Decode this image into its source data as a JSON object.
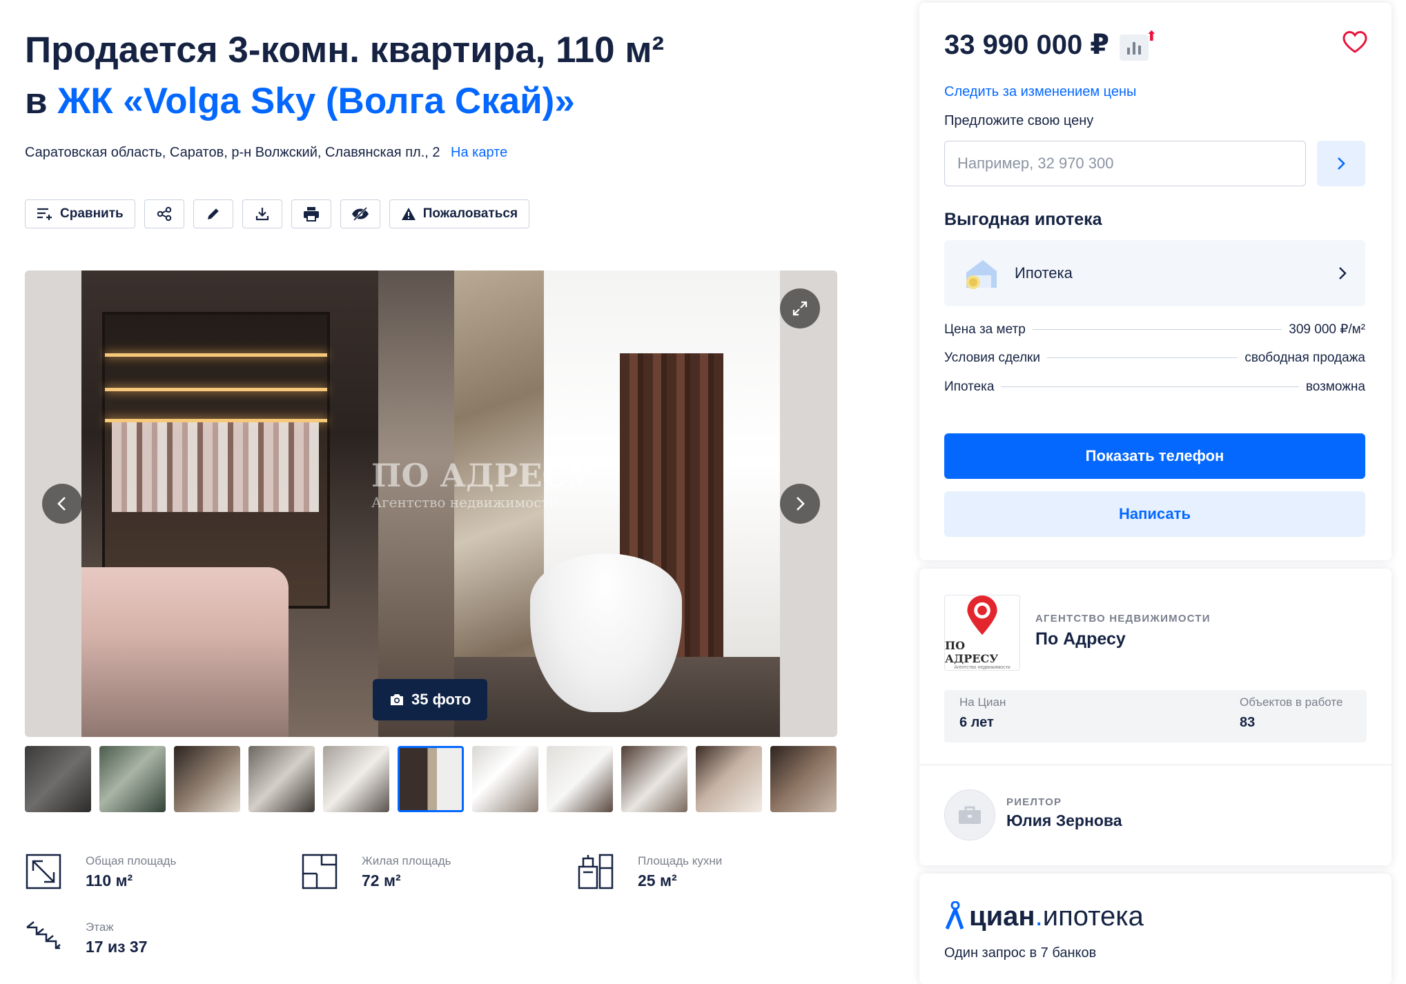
{
  "listing": {
    "title_line1": "Продается 3-комн. квартира, 110 м²",
    "title_prefix": "в",
    "complex_name": "ЖК «Volga Sky (Волга Скай)»",
    "address": "Саратовская область, Саратов, р-н Волжский, Славянская пл., 2",
    "map_link": "На карте"
  },
  "toolbar": {
    "compare_label": "Сравнить",
    "complain_label": "Пожаловаться",
    "icons": [
      "compare-icon",
      "share-icon",
      "edit-icon",
      "download-icon",
      "print-icon",
      "hide-icon",
      "warning-icon"
    ]
  },
  "gallery": {
    "photo_count_label": "35 фото",
    "watermark_title": "ПО АДРЕСУ",
    "watermark_sub": "Агентство недвижимости",
    "thumbnails_visible": 11,
    "active_thumbnail": 6
  },
  "facts": [
    {
      "label": "Общая площадь",
      "value": "110 м²",
      "icon": "total-area-icon"
    },
    {
      "label": "Жилая площадь",
      "value": "72 м²",
      "icon": "living-area-icon"
    },
    {
      "label": "Площадь кухни",
      "value": "25 м²",
      "icon": "kitchen-icon"
    },
    {
      "label": "Этаж",
      "value": "17 из 37",
      "icon": "stairs-icon"
    }
  ],
  "price_card": {
    "price": "33 990 000 ₽",
    "follow_price": "Следить за изменением цены",
    "offer_label": "Предложите свою цену",
    "offer_placeholder": "Например, 32 970 300",
    "mortgage_heading": "Выгодная ипотека",
    "mortgage_item": "Ипотека",
    "details": [
      {
        "label": "Цена за метр",
        "value": "309 000 ₽/м²"
      },
      {
        "label": "Условия сделки",
        "value": "свободная продажа"
      },
      {
        "label": "Ипотека",
        "value": "возможна"
      }
    ],
    "show_phone": "Показать телефон",
    "write": "Написать"
  },
  "agency_card": {
    "logo_text": "ПО АДРЕСУ",
    "logo_sub": "Агентство недвижимости",
    "type": "АГЕНТСТВО НЕДВИЖИМОСТИ",
    "name": "По Адресу",
    "on_cian_label": "На Циан",
    "on_cian_value": "6 лет",
    "objects_label": "Объектов в работе",
    "objects_value": "83",
    "realtor_type": "РИЕЛТОР",
    "realtor_name": "Юлия Зернова"
  },
  "mortgage_promo": {
    "brand_a": "циан",
    "brand_dot": ".",
    "brand_b": "ипотека",
    "subtitle": "Один запрос в 7 банков"
  },
  "colors": {
    "accent": "#0468ff",
    "text": "#152242",
    "muted": "#7a7f8c",
    "price_up": "#e8143c"
  }
}
